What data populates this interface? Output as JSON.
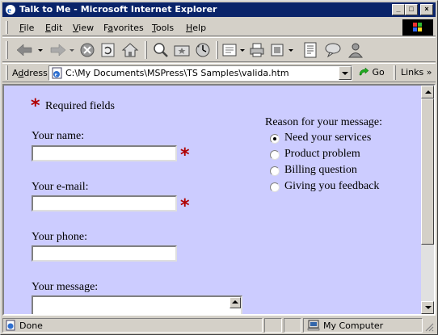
{
  "window": {
    "title": "Talk to Me - Microsoft Internet Explorer",
    "minimize_glyph": "_",
    "maximize_glyph": "□",
    "close_glyph": "×"
  },
  "menu": {
    "items": [
      {
        "label_ul": "F",
        "label_rest": "ile"
      },
      {
        "label_ul": "E",
        "label_rest": "dit"
      },
      {
        "label_ul": "V",
        "label_rest": "iew"
      },
      {
        "label_ul": "",
        "label_rest": "Favorites",
        "ul_index": 1
      },
      {
        "label_ul": "T",
        "label_rest": "ools"
      },
      {
        "label_ul": "H",
        "label_rest": "elp"
      }
    ]
  },
  "toolbar": {
    "icons": [
      "back-icon",
      "forward-icon",
      "stop-icon",
      "refresh-icon",
      "home-icon",
      "search-icon",
      "favorites-icon",
      "history-icon",
      "mail-icon",
      "print-icon",
      "edit-icon",
      "discuss-icon",
      "messenger-icon"
    ]
  },
  "address": {
    "label_ul": "d",
    "label_pre": "A",
    "label_post": "dress",
    "value": "C:\\My Documents\\MSPress\\TS Samples\\valida.htm",
    "go_label": "Go",
    "links_label": "Links",
    "links_chevron": "»"
  },
  "form": {
    "required_text": "Required fields",
    "required_mark": "*",
    "name_label": "Your name:",
    "email_label": "Your e-mail:",
    "phone_label": "Your phone:",
    "message_label": "Your message:",
    "name_value": "",
    "email_value": "",
    "phone_value": "",
    "reason_label": "Reason for your message:",
    "reasons": [
      {
        "label": "Need your services",
        "checked": true
      },
      {
        "label": "Product problem",
        "checked": false
      },
      {
        "label": "Billing question",
        "checked": false
      },
      {
        "label": "Giving you feedback",
        "checked": false
      }
    ]
  },
  "status": {
    "text": "Done",
    "zone": "My Computer"
  },
  "colors": {
    "page_background": "#ccccff",
    "required_mark": "#b00000",
    "titlebar": "#0a246a"
  }
}
